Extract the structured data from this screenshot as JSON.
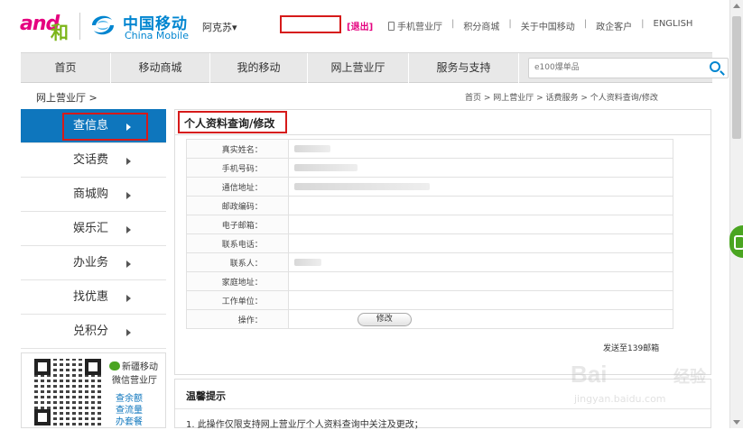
{
  "header": {
    "and_logo_text": "and",
    "and_logo_he": "和",
    "cm_name_cn": "中国移动",
    "cm_name_en": "China Mobile",
    "city": "阿克苏",
    "logout": "[退出]",
    "links": [
      "手机营业厅",
      "积分商城",
      "关于中国移动",
      "政企客户",
      "ENGLISH"
    ]
  },
  "nav": {
    "items": [
      "首页",
      "移动商城",
      "我的移动",
      "网上营业厅",
      "服务与支持"
    ],
    "search_placeholder": "e100爆单品"
  },
  "breadcrumb": {
    "left": "网上营业厅 >",
    "right": "首页 > 网上营业厅 > 话费服务 > 个人资料查询/修改"
  },
  "sidebar": {
    "items": [
      "查信息",
      "交话费",
      "商城购",
      "娱乐汇",
      "办业务",
      "找优惠",
      "兑积分"
    ],
    "active_index": 0
  },
  "wechat": {
    "title": "新疆移动",
    "subtitle": "微信营业厅",
    "links": [
      "查余额",
      "查流量",
      "办套餐"
    ]
  },
  "panel": {
    "title": "个人资料查询/修改",
    "fields": [
      {
        "label": "真实姓名："
      },
      {
        "label": "手机号码："
      },
      {
        "label": "通信地址："
      },
      {
        "label": "邮政编码："
      },
      {
        "label": "电子邮箱："
      },
      {
        "label": "联系电话："
      },
      {
        "label": "联系人："
      },
      {
        "label": "家庭地址："
      },
      {
        "label": "工作单位："
      },
      {
        "label": "操作："
      }
    ],
    "edit_button": "修改",
    "send_mail": "发送至139邮箱"
  },
  "tips": {
    "title": "温馨提示",
    "text": "1. 此操作仅限支持网上营业厅个人资料查询中关注及更改；"
  },
  "watermark": {
    "bai": "Bai",
    "jy": "经验",
    "url": "jingyan.baidu.com"
  },
  "colors": {
    "brand_blue": "#0e76bd",
    "cm_blue": "#0085d0",
    "and_pink": "#e5007f",
    "highlight_red": "#d61a1a"
  }
}
